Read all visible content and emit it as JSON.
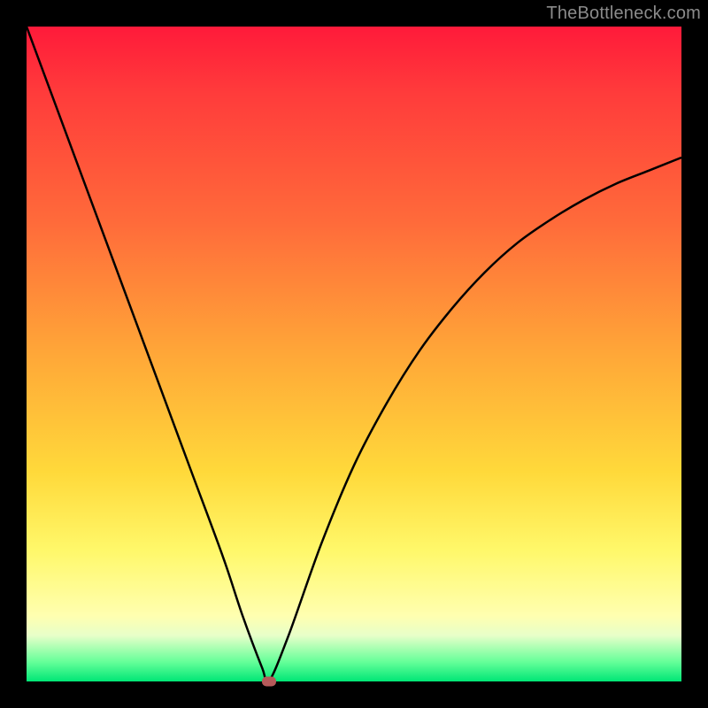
{
  "watermark": "TheBottleneck.com",
  "chart_data": {
    "type": "line",
    "title": "",
    "xlabel": "",
    "ylabel": "",
    "xlim": [
      0,
      100
    ],
    "ylim": [
      0,
      100
    ],
    "x": [
      0,
      5,
      10,
      15,
      20,
      25,
      30,
      33,
      36,
      37,
      40,
      45,
      50,
      55,
      60,
      65,
      70,
      75,
      80,
      85,
      90,
      95,
      100
    ],
    "y": [
      100,
      86.5,
      73.0,
      59.5,
      46.0,
      32.5,
      19.0,
      10.0,
      2.0,
      0,
      7.0,
      21.0,
      33.0,
      42.5,
      50.5,
      57.0,
      62.5,
      67.0,
      70.5,
      73.5,
      76.0,
      78.0,
      80.0
    ],
    "gradient_stops": [
      {
        "pct": 0,
        "color": "#ff1a3a"
      },
      {
        "pct": 10,
        "color": "#ff3b3b"
      },
      {
        "pct": 30,
        "color": "#ff6b3a"
      },
      {
        "pct": 50,
        "color": "#ffa738"
      },
      {
        "pct": 68,
        "color": "#ffd93a"
      },
      {
        "pct": 80,
        "color": "#fff86a"
      },
      {
        "pct": 90,
        "color": "#ffffb0"
      },
      {
        "pct": 93,
        "color": "#e7ffc9"
      },
      {
        "pct": 97,
        "color": "#66ff99"
      },
      {
        "pct": 100,
        "color": "#00e676"
      }
    ],
    "marker": {
      "x": 37,
      "y": 0,
      "color": "#b55a5a"
    }
  }
}
